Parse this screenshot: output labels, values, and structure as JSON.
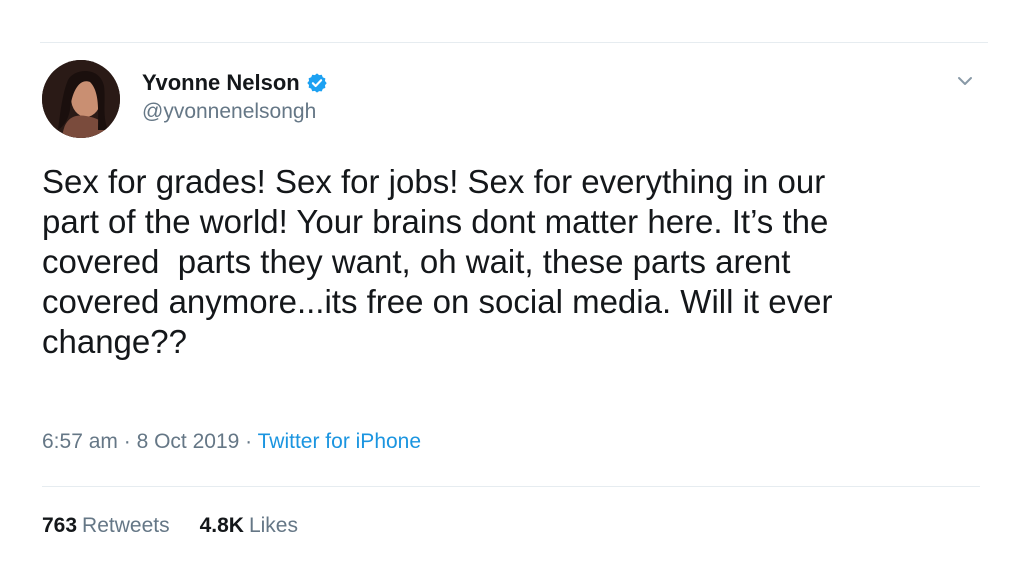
{
  "tweet": {
    "display_name": "Yvonne Nelson",
    "handle": "@yvonnenelsongh",
    "verified_icon": "verified-badge-icon",
    "caret_icon": "chevron-down-icon",
    "text": "Sex for grades! Sex for jobs! Sex for everything in our\npart of the world! Your brains dont matter here. It’s the\ncovered  parts they want, oh wait, these parts arent\ncovered anymore...its free on social media. Will it ever\nchange??",
    "time": "6:57 am",
    "separator": "·",
    "date": "8 Oct 2019",
    "source": "Twitter for iPhone",
    "stats": {
      "retweets_count": "763",
      "retweets_label": "Retweets",
      "likes_count": "4.8K",
      "likes_label": "Likes"
    }
  },
  "colors": {
    "text": "#14171a",
    "secondary": "#657786",
    "link": "#1b95e0",
    "verified": "#1da1f2",
    "divider": "#e6ecf0"
  }
}
